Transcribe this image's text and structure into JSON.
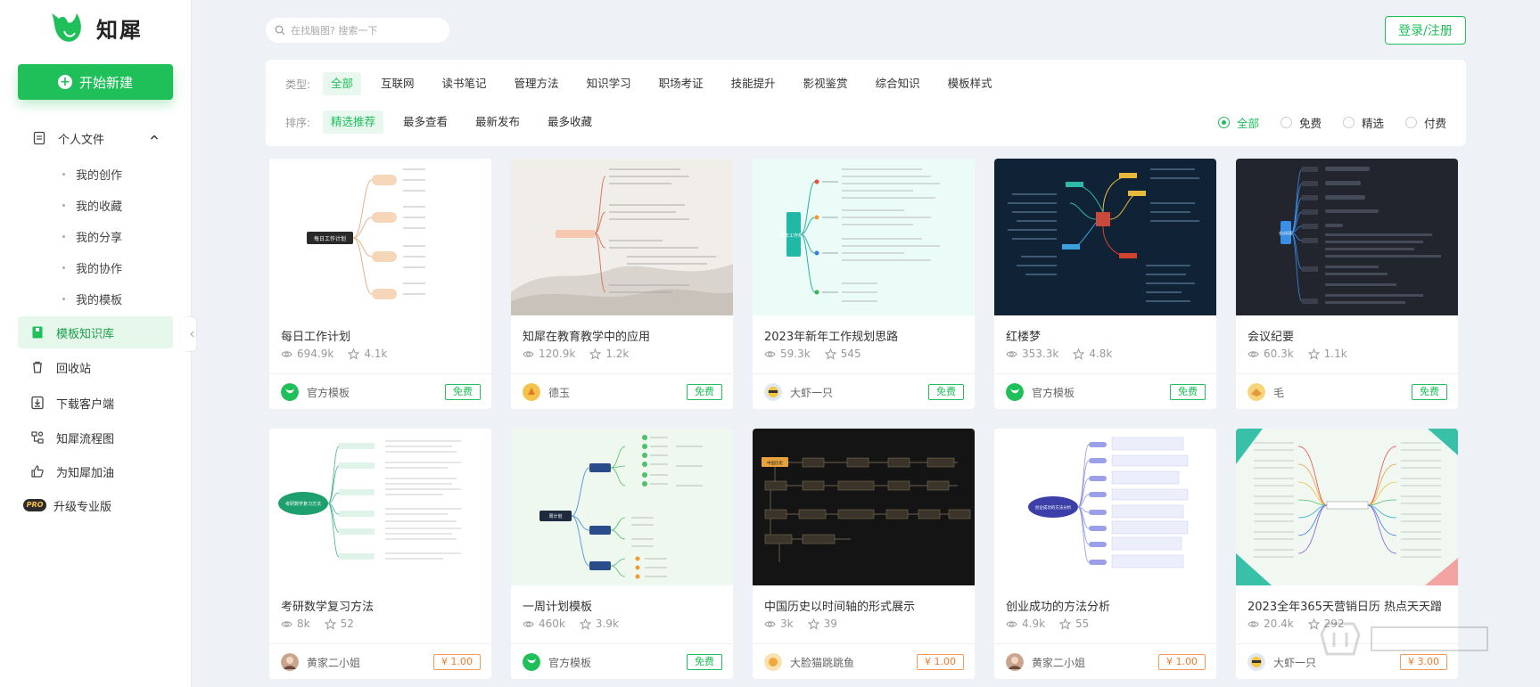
{
  "brand": {
    "name": "知犀",
    "accent": "#1fbf5a"
  },
  "sidebar": {
    "new_button": "开始新建",
    "personal_files": "个人文件",
    "sub_items": [
      "我的创作",
      "我的收藏",
      "我的分享",
      "我的协作",
      "我的模板"
    ],
    "items": [
      {
        "label": "模板知识库",
        "icon": "book-icon",
        "active": true
      },
      {
        "label": "回收站",
        "icon": "trash-icon"
      },
      {
        "label": "下载客户端",
        "icon": "download-icon"
      },
      {
        "label": "知犀流程图",
        "icon": "flowchart-icon"
      },
      {
        "label": "为知犀加油",
        "icon": "thumbs-up-icon"
      },
      {
        "label": "升级专业版",
        "icon": "pro-badge",
        "badge": "PRO"
      }
    ]
  },
  "search": {
    "placeholder": "在找脑图? 搜索一下"
  },
  "header": {
    "login": "登录/注册"
  },
  "filters": {
    "type_label": "类型:",
    "types": [
      "全部",
      "互联网",
      "读书笔记",
      "管理方法",
      "知识学习",
      "职场考证",
      "技能提升",
      "影视鉴赏",
      "综合知识",
      "模板样式"
    ],
    "sort_label": "排序:",
    "sorts": [
      "精选推荐",
      "最多查看",
      "最新发布",
      "最多收藏"
    ],
    "prices": [
      "全部",
      "免费",
      "精选",
      "付费"
    ]
  },
  "cards": [
    {
      "title": "每日工作计划",
      "views": "694.9k",
      "stars": "4.1k",
      "author": "官方模板",
      "price": "免费",
      "free": true
    },
    {
      "title": "知犀在教育教学中的应用",
      "views": "120.9k",
      "stars": "1.2k",
      "author": "德玉",
      "price": "免费",
      "free": true
    },
    {
      "title": "2023年新年工作规划思路",
      "views": "59.3k",
      "stars": "545",
      "author": "大虾一只",
      "price": "免费",
      "free": true
    },
    {
      "title": "红楼梦",
      "views": "353.3k",
      "stars": "4.8k",
      "author": "官方模板",
      "price": "免费",
      "free": true
    },
    {
      "title": "会议纪要",
      "views": "60.3k",
      "stars": "1.1k",
      "author": "毛",
      "price": "免费",
      "free": true
    },
    {
      "title": "考研数学复习方法",
      "views": "8k",
      "stars": "52",
      "author": "黄家二小姐",
      "price": "¥ 1.00",
      "free": false
    },
    {
      "title": "一周计划模板",
      "views": "460k",
      "stars": "3.9k",
      "author": "官方模板",
      "price": "免费",
      "free": true
    },
    {
      "title": "中国历史以时间轴的形式展示",
      "views": "3k",
      "stars": "39",
      "author": "大脸猫跳跳鱼",
      "price": "¥ 1.00",
      "free": false
    },
    {
      "title": "创业成功的方法分析",
      "views": "4.9k",
      "stars": "55",
      "author": "黄家二小姐",
      "price": "¥ 1.00",
      "free": false
    },
    {
      "title": "2023全年365天营销日历 热点天天蹭",
      "views": "20.4k",
      "stars": "292",
      "author": "大虾一只",
      "price": "¥ 3.00",
      "free": false
    }
  ],
  "thumb_labels": [
    "每日工作计划",
    "新年工作规划",
    "会议纪要",
    "考研数学复习方法",
    "周计划",
    "中国历史",
    "创业成功的方法分析"
  ]
}
